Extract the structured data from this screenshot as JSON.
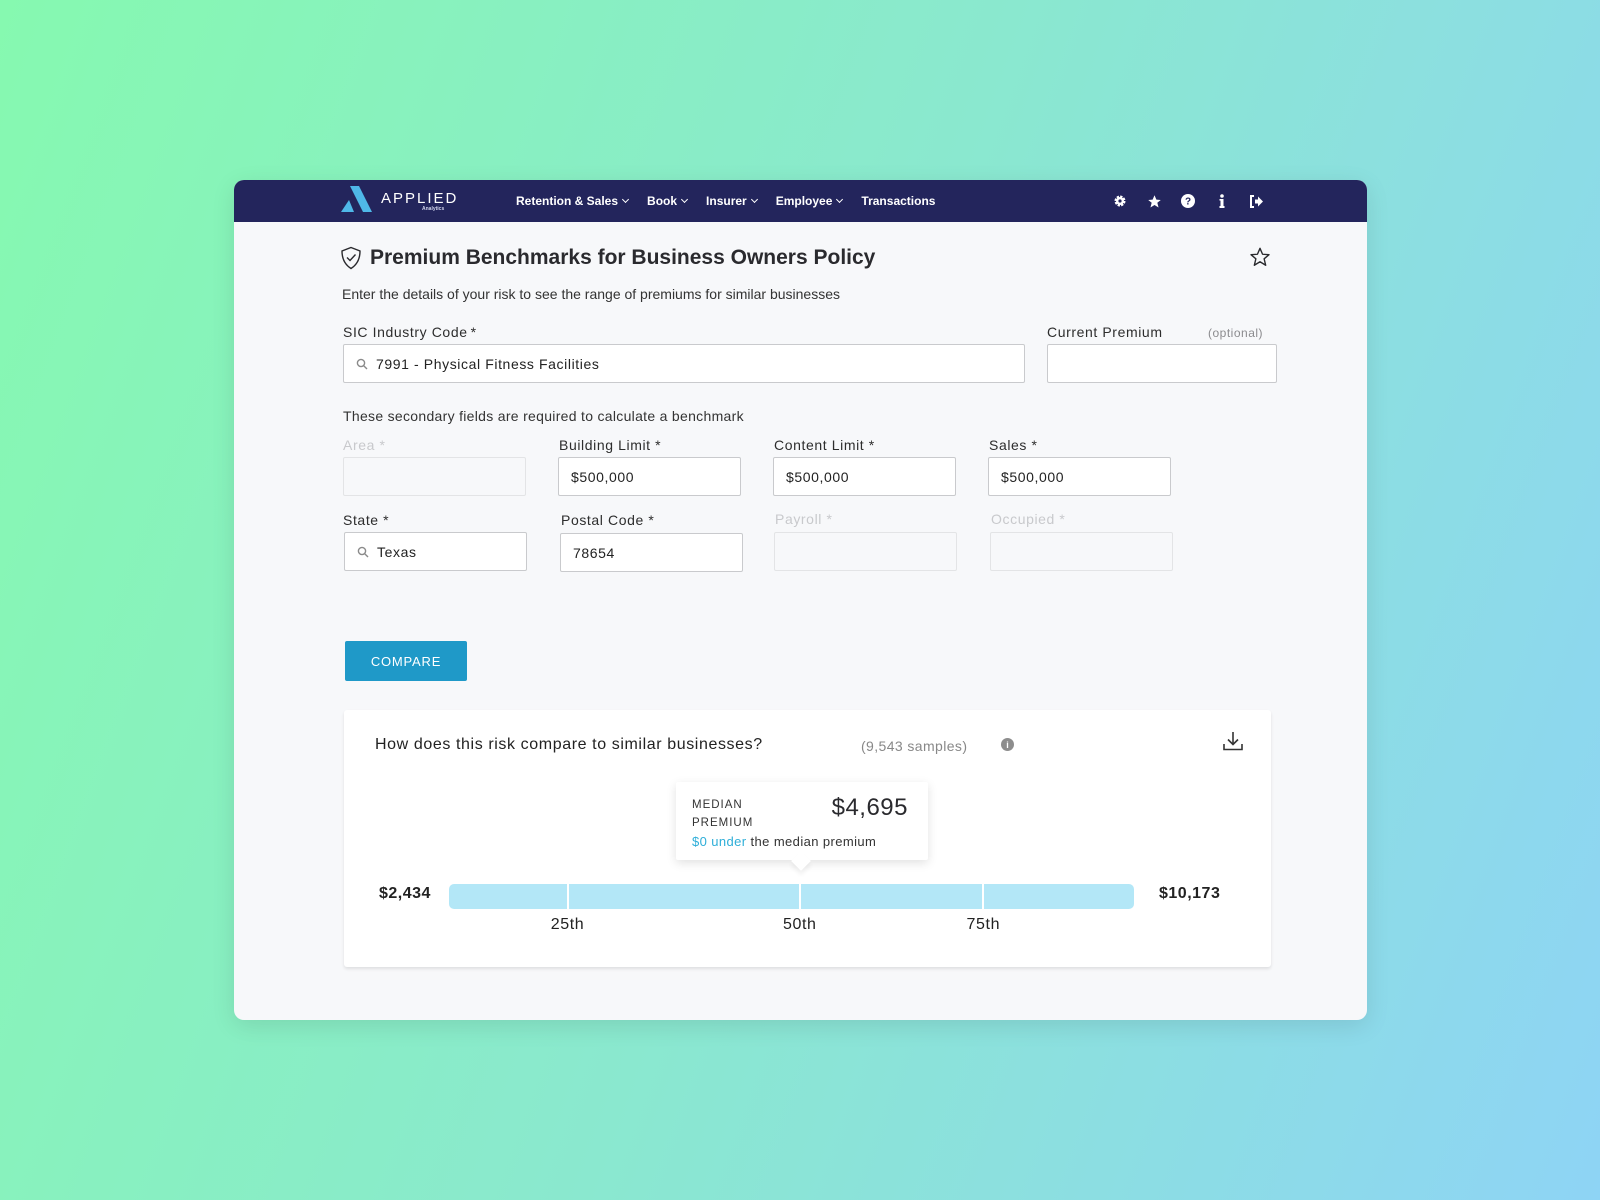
{
  "nav": {
    "logo_text": "APPLIED",
    "logo_sub": "Analytics",
    "menu": [
      {
        "label": "Retention & Sales",
        "dropdown": true
      },
      {
        "label": "Book",
        "dropdown": true
      },
      {
        "label": "Insurer",
        "dropdown": true
      },
      {
        "label": "Employee",
        "dropdown": true
      },
      {
        "label": "Transactions",
        "dropdown": false
      }
    ],
    "icons": [
      "gear-icon",
      "star-icon",
      "help-icon",
      "info-icon",
      "logout-icon"
    ]
  },
  "page": {
    "title": "Premium Benchmarks for Business Owners Policy",
    "subtitle": "Enter the details of your risk to see the range of premiums for similar businesses"
  },
  "form": {
    "sic": {
      "label": "SIC Industry Code",
      "required": "*",
      "value": "7991 - Physical Fitness Facilities"
    },
    "current_premium": {
      "label": "Current Premium",
      "optional": "(optional)",
      "value": ""
    },
    "secondary_note": "These secondary fields are required to calculate a benchmark",
    "area": {
      "label": "Area *",
      "value": ""
    },
    "building_limit": {
      "label": "Building Limit *",
      "value": "$500,000"
    },
    "content_limit": {
      "label": "Content Limit *",
      "value": "$500,000"
    },
    "sales": {
      "label": "Sales *",
      "value": "$500,000"
    },
    "state": {
      "label": "State *",
      "value": "Texas"
    },
    "postal_code": {
      "label": "Postal Code *",
      "value": "78654"
    },
    "payroll": {
      "label": "Payroll *",
      "value": ""
    },
    "occupied": {
      "label": "Occupied *",
      "value": ""
    },
    "compare_label": "COMPARE"
  },
  "result": {
    "title": "How does this risk compare to similar businesses?",
    "samples": "(9,543 samples)",
    "tooltip": {
      "label": "MEDIAN PREMIUM",
      "value": "$4,695",
      "diff_accent": "$0 under",
      "diff_rest": " the median premium"
    },
    "min": "$2,434",
    "max": "$10,173",
    "bar_color": "#b3e7f7",
    "percentiles": [
      {
        "label": "25th",
        "position": 0.173
      },
      {
        "label": "50th",
        "position": 0.512
      },
      {
        "label": "75th",
        "position": 0.78
      }
    ]
  },
  "colors": {
    "navbar": "#23255c",
    "accent": "#1f99c8",
    "highlight": "#2eaed8"
  }
}
